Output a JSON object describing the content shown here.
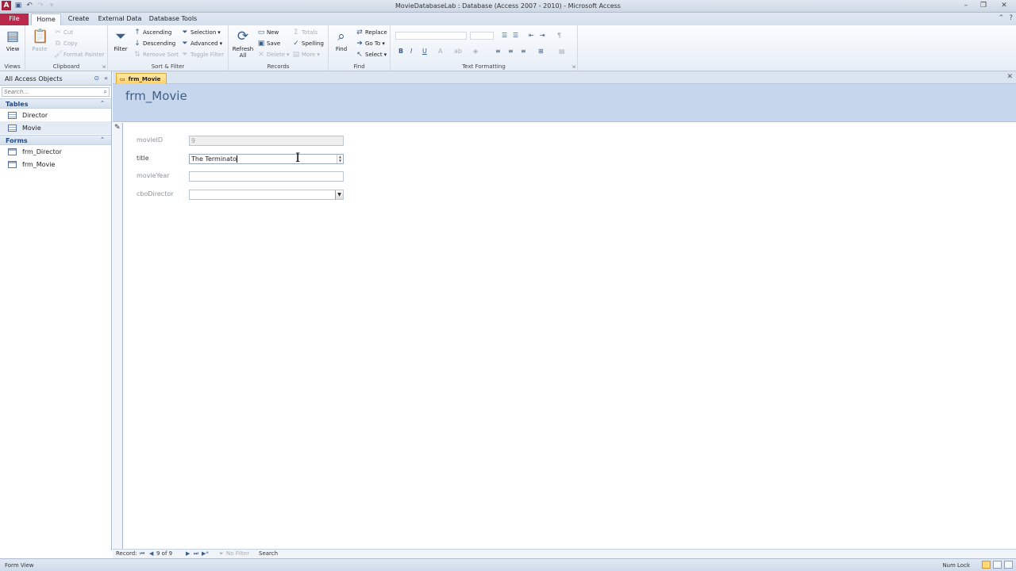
{
  "window": {
    "title": "MovieDatabaseLab : Database (Access 2007 - 2010) - Microsoft Access",
    "app_icon_letter": "A",
    "controls": [
      "–",
      "❐",
      "✕"
    ]
  },
  "ribbon_tabs": [
    {
      "label": "File"
    },
    {
      "label": "Home"
    },
    {
      "label": "Create"
    },
    {
      "label": "External Data"
    },
    {
      "label": "Database Tools"
    }
  ],
  "ribbon": {
    "views": {
      "view": "View",
      "group": "Views"
    },
    "clipboard": {
      "paste": "Paste",
      "cut": "Cut",
      "copy": "Copy",
      "format_painter": "Format Painter",
      "group": "Clipboard"
    },
    "sort_filter": {
      "filter": "Filter",
      "ascending": "Ascending",
      "descending": "Descending",
      "remove_sort": "Remove Sort",
      "selection": "Selection",
      "advanced": "Advanced",
      "toggle_filter": "Toggle Filter",
      "group": "Sort & Filter"
    },
    "records": {
      "refresh": "Refresh All",
      "new": "New",
      "save": "Save",
      "delete": "Delete",
      "totals": "Totals",
      "spelling": "Spelling",
      "more": "More",
      "group": "Records"
    },
    "find": {
      "find": "Find",
      "replace": "Replace",
      "go_to": "Go To",
      "select": "Select",
      "group": "Find"
    },
    "text_formatting": {
      "bold": "B",
      "italic": "I",
      "underline": "U",
      "group": "Text Formatting"
    }
  },
  "nav_pane": {
    "header": "All Access Objects",
    "search_placeholder": "Search...",
    "groups": [
      {
        "label": "Tables",
        "items": [
          "Director",
          "Movie"
        ]
      },
      {
        "label": "Forms",
        "items": [
          "frm_Director",
          "frm_Movie"
        ]
      }
    ]
  },
  "document": {
    "tab_label": "frm_Movie",
    "form_title": "frm_Movie",
    "fields": [
      {
        "label": "movieID",
        "value": "9"
      },
      {
        "label": "title",
        "value": "The Terminato"
      },
      {
        "label": "movieYear",
        "value": ""
      },
      {
        "label": "cboDirector",
        "value": ""
      }
    ]
  },
  "record_nav": {
    "label": "Record:",
    "position": "9 of 9",
    "filter": "No Filter",
    "search": "Search"
  },
  "status": {
    "left": "Form View",
    "num_lock": "Num Lock"
  }
}
